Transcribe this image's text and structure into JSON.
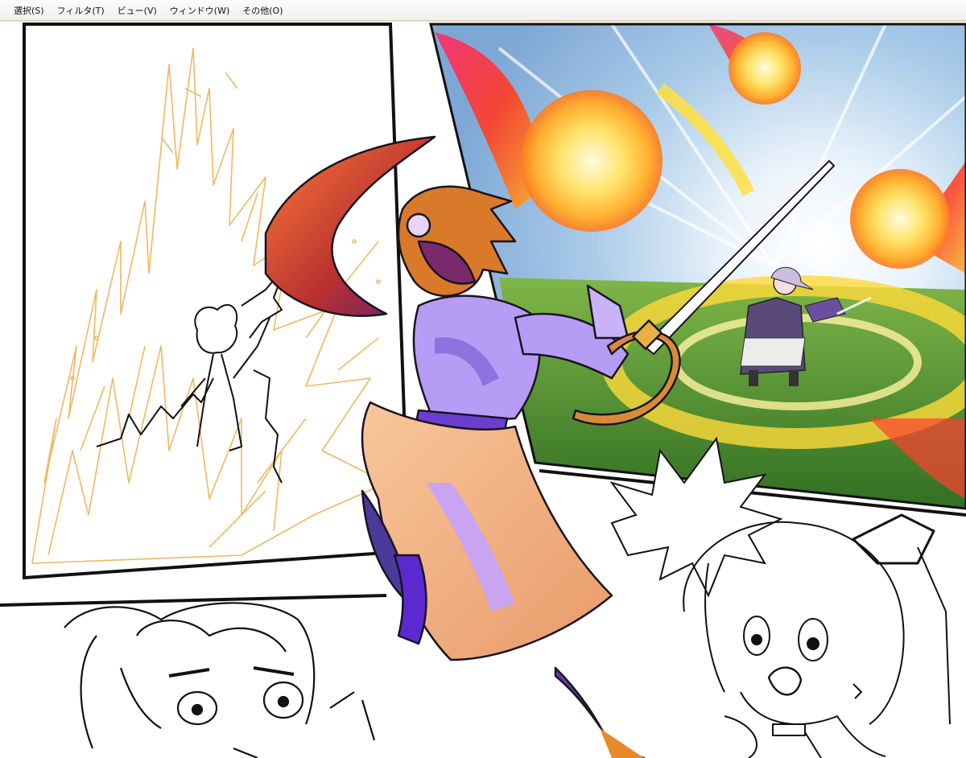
{
  "menubar": {
    "items": [
      {
        "label": "選択(S)"
      },
      {
        "label": "フィルタ(T)"
      },
      {
        "label": "ビュー(V)"
      },
      {
        "label": "ウィンドウ(W)"
      },
      {
        "label": "その他(O)"
      }
    ]
  },
  "canvas": {
    "background": "#ffffff",
    "colors": {
      "panel_border": "#111111",
      "sketch_orange": "#f0b860",
      "sky_blue": "#a9cbe8",
      "fire_core": "#fff3a0",
      "fire_outer": "#ff3a20",
      "grass_green": "#4f8f2c",
      "dress_purple": "#b79cf5",
      "skirt_peach": "#f2b57a",
      "ribbon_red": "#c0392b",
      "hair_orange": "#d9792a"
    },
    "icons": [
      "sword-icon",
      "fireball-icon",
      "speech-burst-icon"
    ]
  }
}
